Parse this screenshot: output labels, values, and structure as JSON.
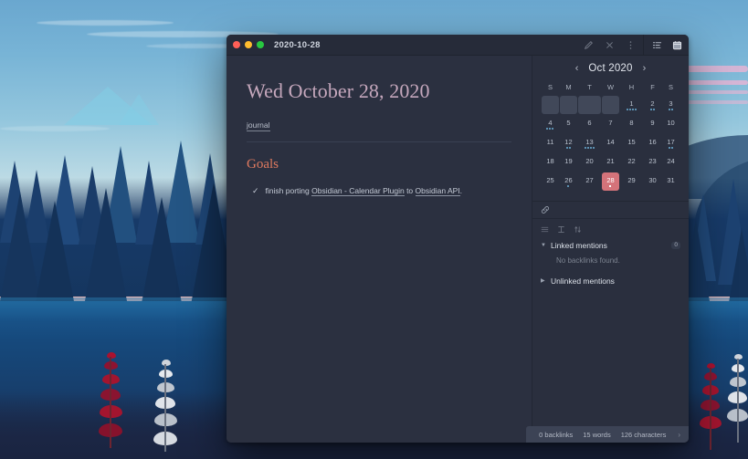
{
  "window": {
    "title": "2020-10-28",
    "traffic_lights": [
      "close-red",
      "minimize-yellow",
      "maximize-green"
    ],
    "toolbar_icons": [
      "pencil-icon",
      "close-icon",
      "more-vertical-icon"
    ],
    "sidebar_toolbar_icons": [
      "outline-list-icon",
      "calendar-icon"
    ]
  },
  "note": {
    "title": "Wed October 28, 2020",
    "tag": "journal",
    "heading": "Goals",
    "task": {
      "checked": true,
      "check_glyph": "✓",
      "prefix": "finish porting ",
      "link1": "Obsidian - Calendar Plugin",
      "mid": " to ",
      "link2": "Obsidian API",
      "suffix": "."
    }
  },
  "calendar": {
    "prev_label": "‹",
    "next_label": "›",
    "month": "Oct 2020",
    "weekdays": [
      "S",
      "M",
      "T",
      "W",
      "H",
      "F",
      "S"
    ],
    "today": 28,
    "today_color": "#d4737a",
    "dot_color": "#5b8fb0",
    "weeks": [
      [
        {
          "day": null,
          "dots": 0
        },
        {
          "day": null,
          "dots": 0
        },
        {
          "day": null,
          "dots": 0
        },
        {
          "day": null,
          "dots": 0
        },
        {
          "day": 1,
          "dots": 4
        },
        {
          "day": 2,
          "dots": 2
        },
        {
          "day": 3,
          "dots": 2
        }
      ],
      [
        {
          "day": 4,
          "dots": 3
        },
        {
          "day": 5,
          "dots": 0
        },
        {
          "day": 6,
          "dots": 0
        },
        {
          "day": 7,
          "dots": 0
        },
        {
          "day": 8,
          "dots": 0
        },
        {
          "day": 9,
          "dots": 0
        },
        {
          "day": 10,
          "dots": 0
        }
      ],
      [
        {
          "day": 11,
          "dots": 0
        },
        {
          "day": 12,
          "dots": 2
        },
        {
          "day": 13,
          "dots": 4
        },
        {
          "day": 14,
          "dots": 0
        },
        {
          "day": 15,
          "dots": 0
        },
        {
          "day": 16,
          "dots": 0
        },
        {
          "day": 17,
          "dots": 2
        }
      ],
      [
        {
          "day": 18,
          "dots": 0
        },
        {
          "day": 19,
          "dots": 0
        },
        {
          "day": 20,
          "dots": 0
        },
        {
          "day": 21,
          "dots": 0
        },
        {
          "day": 22,
          "dots": 0
        },
        {
          "day": 23,
          "dots": 0
        },
        {
          "day": 24,
          "dots": 0
        }
      ],
      [
        {
          "day": 25,
          "dots": 0
        },
        {
          "day": 26,
          "dots": 1
        },
        {
          "day": 27,
          "dots": 0
        },
        {
          "day": 28,
          "dots": 1
        },
        {
          "day": 29,
          "dots": 0
        },
        {
          "day": 30,
          "dots": 0
        },
        {
          "day": 31,
          "dots": 0
        }
      ]
    ]
  },
  "backlinks": {
    "header_icon": "link-icon",
    "tools": [
      "collapse-list-icon",
      "expand-results-icon",
      "sort-order-icon"
    ],
    "linked_label": "Linked mentions",
    "linked_count": "0",
    "empty_text": "No backlinks found.",
    "unlinked_label": "Unlinked mentions"
  },
  "statusbar": {
    "backlinks": "0 backlinks",
    "words": "15 words",
    "characters": "126 characters",
    "resize_glyph": "›"
  }
}
